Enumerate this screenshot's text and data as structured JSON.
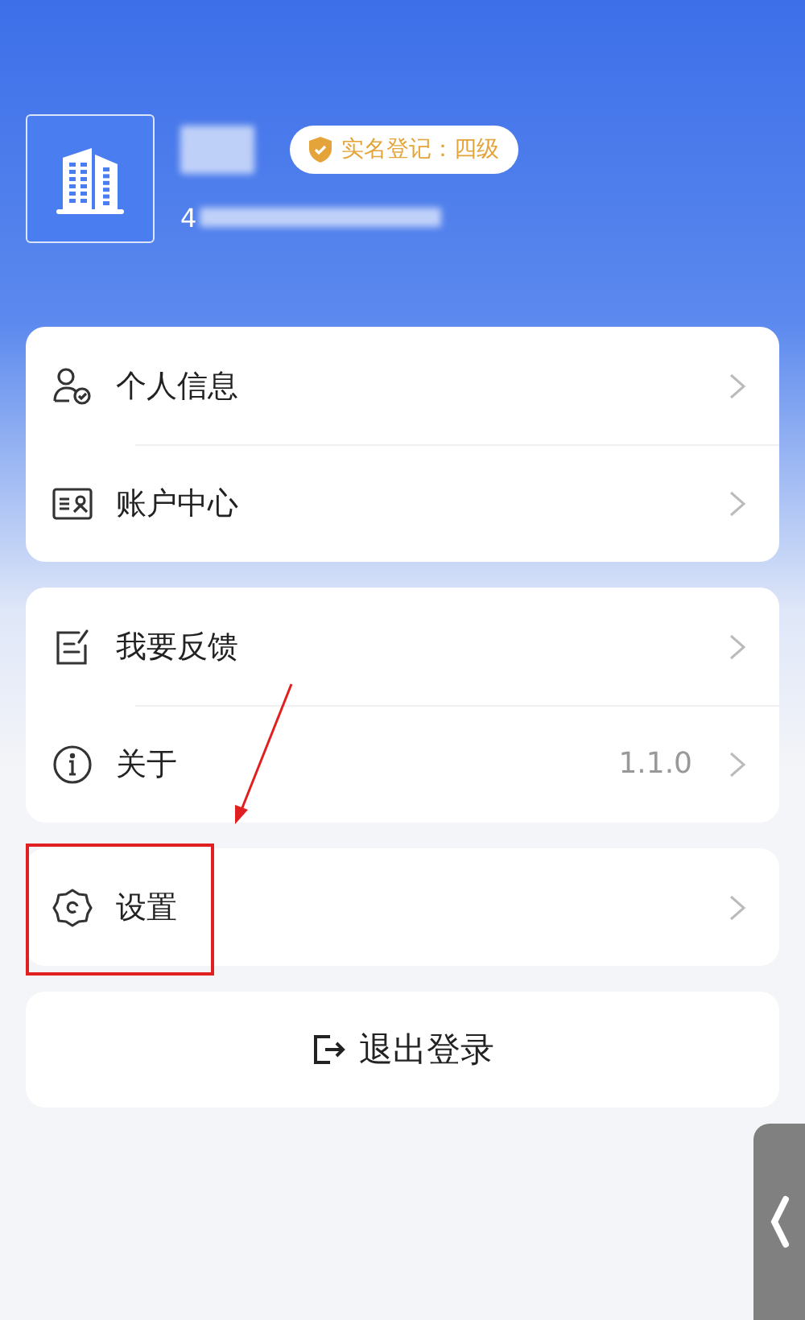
{
  "profile": {
    "account_prefix": "4",
    "badge": "实名登记：四级"
  },
  "groups": [
    {
      "items": [
        {
          "kind": "person",
          "label": "个人信息"
        },
        {
          "kind": "card",
          "label": "账户中心"
        }
      ]
    },
    {
      "items": [
        {
          "kind": "feedback",
          "label": "我要反馈"
        },
        {
          "kind": "info",
          "label": "关于",
          "value": "1.1.0"
        }
      ]
    },
    {
      "items": [
        {
          "kind": "gear",
          "label": "设置"
        }
      ]
    }
  ],
  "logout": {
    "label": "退出登录"
  },
  "annotation": {
    "highlight": true
  }
}
